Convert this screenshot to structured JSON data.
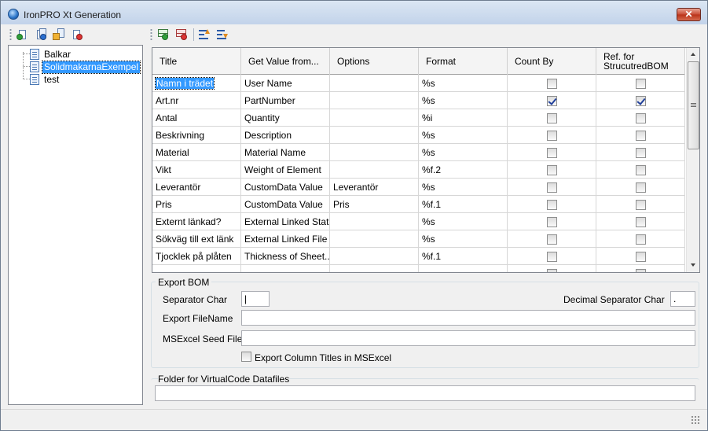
{
  "window": {
    "title": "IronPRO Xt Generation",
    "close_glyph": "✕"
  },
  "tree_toolbar": {
    "buttons": [
      "add-item-icon",
      "copy-item-icon",
      "import-item-icon",
      "delete-item-icon"
    ]
  },
  "grid_toolbar": {
    "buttons": [
      "add-row-icon",
      "delete-row-icon",
      "move-up-icon",
      "move-down-icon"
    ]
  },
  "tree": {
    "items": [
      {
        "label": "Balkar",
        "selected": false
      },
      {
        "label": "SolidmakarnaExempel",
        "selected": true
      },
      {
        "label": "test",
        "selected": false
      }
    ]
  },
  "grid": {
    "columns": [
      {
        "label": "Title"
      },
      {
        "label": "Get Value from..."
      },
      {
        "label": "Options"
      },
      {
        "label": "Format"
      },
      {
        "label": "Count By"
      },
      {
        "label": "Ref. for StrucutredBOM"
      }
    ],
    "rows": [
      {
        "title": "Namn i trädet",
        "get_value": "User Name",
        "options": "",
        "format": "%s",
        "count_by": false,
        "ref_bom": false
      },
      {
        "title": "Art.nr",
        "get_value": "PartNumber",
        "options": "",
        "format": "%s",
        "count_by": true,
        "ref_bom": true
      },
      {
        "title": "Antal",
        "get_value": "Quantity",
        "options": "",
        "format": "%i",
        "count_by": false,
        "ref_bom": false
      },
      {
        "title": "Beskrivning",
        "get_value": "Description",
        "options": "",
        "format": "%s",
        "count_by": false,
        "ref_bom": false
      },
      {
        "title": "Material",
        "get_value": "Material Name",
        "options": "",
        "format": "%s",
        "count_by": false,
        "ref_bom": false
      },
      {
        "title": "Vikt",
        "get_value": "Weight of Element",
        "options": "",
        "format": "%f.2",
        "count_by": false,
        "ref_bom": false
      },
      {
        "title": "Leverantör",
        "get_value": "CustomData Value",
        "options": "Leverantör",
        "format": "%s",
        "count_by": false,
        "ref_bom": false
      },
      {
        "title": "Pris",
        "get_value": "CustomData Value",
        "options": "Pris",
        "format": "%f.1",
        "count_by": false,
        "ref_bom": false
      },
      {
        "title": "Externt länkad?",
        "get_value": "External Linked Stat...",
        "options": "",
        "format": "%s",
        "count_by": false,
        "ref_bom": false
      },
      {
        "title": "Sökväg till ext länk",
        "get_value": "External Linked File",
        "options": "",
        "format": "%s",
        "count_by": false,
        "ref_bom": false
      },
      {
        "title": "Tjocklek på plåten",
        "get_value": "Thickness of Sheet...",
        "options": "",
        "format": "%f.1",
        "count_by": false,
        "ref_bom": false
      },
      {
        "title": "",
        "get_value": "",
        "options": "",
        "format": "",
        "count_by": false,
        "ref_bom": false
      }
    ]
  },
  "export_bom": {
    "title": "Export BOM",
    "separator_label": "Separator Char",
    "separator_value": "|",
    "decimal_label": "Decimal Separator Char",
    "decimal_value": ".",
    "filename_label": "Export FileName",
    "filename_value": "",
    "seed_label": "MSExcel Seed File",
    "seed_value": "",
    "titles_label": "Export Column Titles in MSExcel",
    "titles_checked": false
  },
  "virtual_code": {
    "title": "Folder for VirtualCode Datafiles",
    "value": ""
  }
}
